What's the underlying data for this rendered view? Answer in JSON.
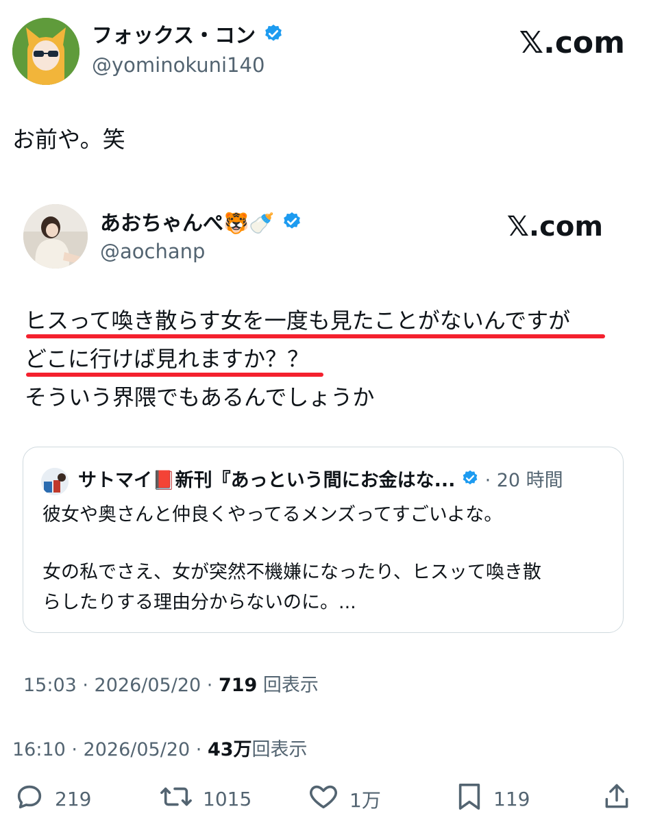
{
  "author": {
    "name": "フォックス・コン",
    "handle": "@yominokuni140",
    "source": "𝕏.com"
  },
  "tweet_text": "お前や。笑",
  "quoted": {
    "name": "あおちゃんぺ🐯🍼",
    "handle": "@aochanp",
    "source": "𝕏.com",
    "lines": [
      "ヒスって喚き散らす女を一度も見たことがないんですが",
      "どこに行けば見れますか？？",
      "そういう界隈でもあるんでしょうか"
    ],
    "nested": {
      "name": "サトマイ📕新刊『あっという間にお金はな...",
      "time": "· 20 時間",
      "line1": "彼女や奥さんと仲良くやってるメンズってすごいよな。",
      "line2": "女の私でさえ、女が突然不機嫌になったり、ヒスッて喚き散",
      "line3": "らしたりする理由分からないのに。..."
    },
    "meta_time": "15:03 · 2026/05/20 · ",
    "meta_views": "719",
    "meta_views_label": " 回表示"
  },
  "meta": {
    "time": "16:10 · 2026/05/20 · ",
    "views": "43万",
    "views_label": "回表示"
  },
  "actions": {
    "reply_count": "219",
    "repost_count": "1015",
    "like_count": "1万",
    "bookmark_count": "119"
  },
  "colors": {
    "verified": "#1d9bf0",
    "underline": "#f4212e",
    "muted": "#536471"
  }
}
